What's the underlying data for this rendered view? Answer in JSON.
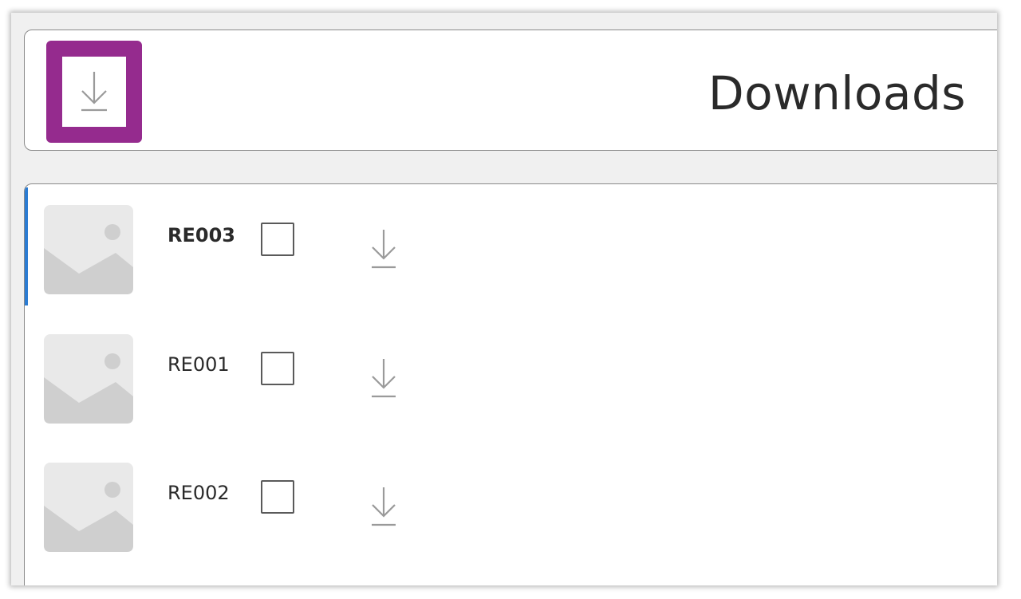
{
  "header": {
    "title": "Downloads",
    "icon": "download-icon",
    "highlight_color": "#952b8e"
  },
  "list": {
    "selection_color": "#2b7cd3",
    "items": [
      {
        "label": "RE003",
        "selected": true,
        "checked": false,
        "thumbnail_icon": "image-placeholder-icon",
        "action_icon": "download-icon"
      },
      {
        "label": "RE001",
        "selected": false,
        "checked": false,
        "thumbnail_icon": "image-placeholder-icon",
        "action_icon": "download-icon"
      },
      {
        "label": "RE002",
        "selected": false,
        "checked": false,
        "thumbnail_icon": "image-placeholder-icon",
        "action_icon": "download-icon"
      }
    ]
  }
}
